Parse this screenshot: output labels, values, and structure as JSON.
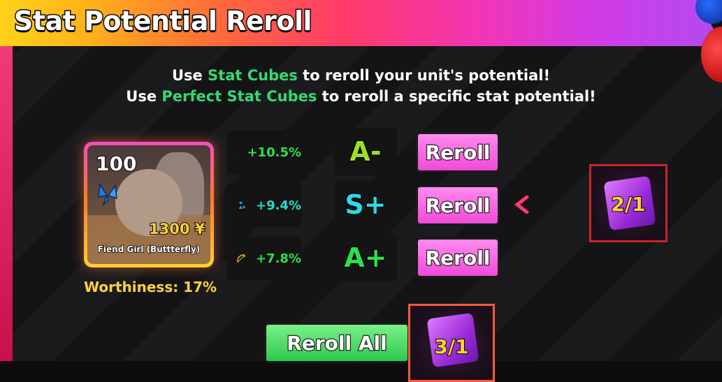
{
  "title": "Stat Potential Reroll",
  "instructions": {
    "line1_pre": "Use ",
    "line1_highlight": "Stat Cubes",
    "line1_post": " to reroll your unit's potential!",
    "line2_pre": "Use ",
    "line2_highlight": "Perfect Stat Cubes",
    "line2_post": " to reroll a specific stat potential!"
  },
  "unit": {
    "level": "100",
    "cost": "1300 ¥",
    "name": "Fiend Girl (Buttterfly)",
    "worthiness": "Worthiness: 17%"
  },
  "stats": [
    {
      "icon": "damage-sword-icon",
      "value": "+10.5%",
      "grade": "A-",
      "grade_color": "#9ae02a",
      "value_color": "#2ee04a",
      "reroll_label": "Reroll"
    },
    {
      "icon": "cooldown-hourglass-icon",
      "value": "+9.4%",
      "grade": "S+",
      "grade_color": "#2ed8e8",
      "value_color": "#2ed8d0",
      "reroll_label": "Reroll"
    },
    {
      "icon": "range-bow-icon",
      "value": "+7.8%",
      "grade": "A+",
      "grade_color": "#2ee04a",
      "value_color": "#2ee04a",
      "reroll_label": "Reroll"
    }
  ],
  "perfect_cube_count": "2/1",
  "stat_cube_count": "3/1",
  "reroll_all_label": "Reroll All"
}
